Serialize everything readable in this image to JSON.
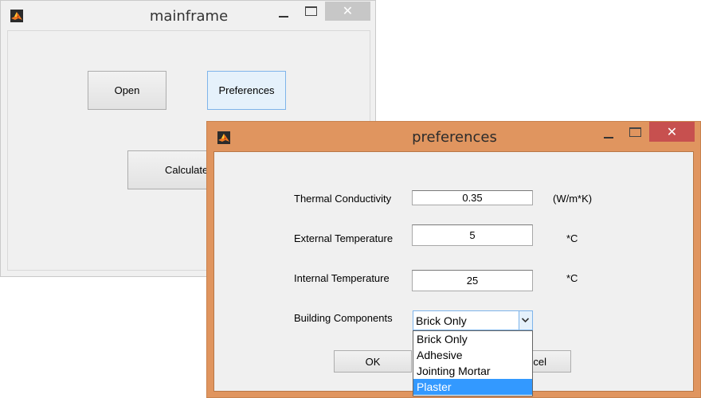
{
  "mainframe": {
    "title": "mainframe",
    "buttons": {
      "open": "Open",
      "preferences": "Preferences",
      "calculate": "Calculate"
    },
    "close_glyph": "✕"
  },
  "preferences": {
    "title": "preferences",
    "close_glyph": "✕",
    "fields": {
      "thermal_conductivity": {
        "label": "Thermal Conductivity",
        "value": "0.35",
        "unit": "(W/m*K)"
      },
      "external_temperature": {
        "label": "External Temperature",
        "value": "5",
        "unit": "*C"
      },
      "internal_temperature": {
        "label": "Internal Temperature",
        "value": "25",
        "unit": "*C"
      }
    },
    "building_components": {
      "label": "Building Components",
      "selected": "Brick Only",
      "options": [
        "Brick Only",
        "Adhesive",
        "Jointing Mortar",
        "Plaster"
      ],
      "highlighted": "Plaster"
    },
    "buttons": {
      "ok": "OK",
      "cancel_visible": "ncel"
    }
  },
  "icons": {
    "app": "matlab-logo-icon",
    "minimize": "minimize-icon",
    "maximize": "maximize-icon",
    "close": "close-icon",
    "dropdown_arrow": "chevron-down-icon"
  },
  "colors": {
    "active_frame": "#e0955f",
    "close_active": "#c7504f",
    "selection": "#3399ff"
  }
}
